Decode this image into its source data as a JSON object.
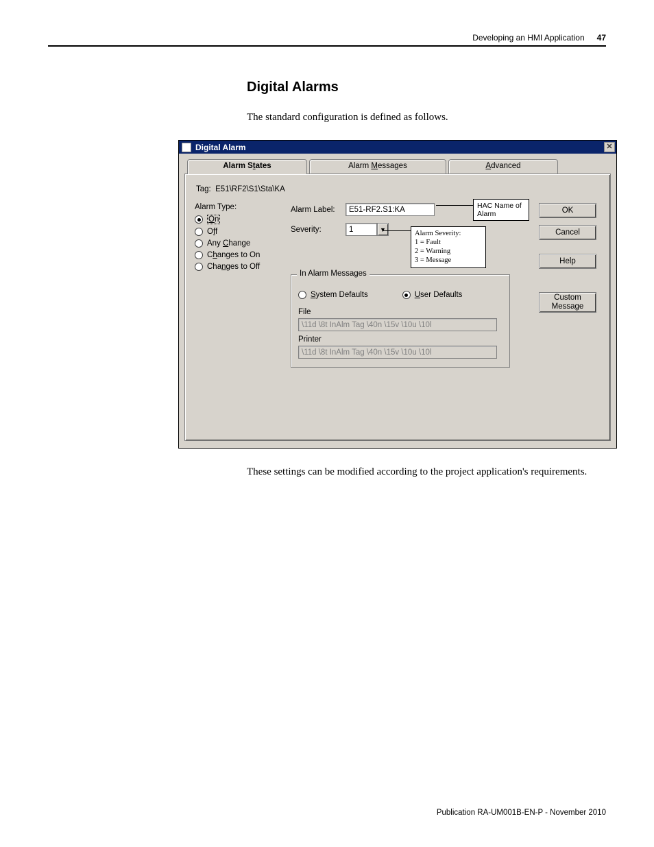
{
  "header": {
    "chapter": "Developing an HMI Application",
    "page_number": "47"
  },
  "section_title": "Digital Alarms",
  "intro_text": "The standard configuration is defined as follows.",
  "outro_text": "These settings can be modified according to the project application's requirements.",
  "footer": "Publication RA-UM001B-EN-P - November 2010",
  "dialog": {
    "title": "Digital Alarm",
    "tabs": {
      "states_pre": "Alarm S",
      "states_u": "t",
      "states_post": "ates",
      "messages_pre": "Alarm ",
      "messages_u": "M",
      "messages_post": "essages",
      "advanced_u": "A",
      "advanced_post": "dvanced"
    },
    "tag_label": "Tag:",
    "tag_value": "E51\\RF2\\S1\\Sta\\KA",
    "alarm_type_label": "Alarm Type:",
    "radios": {
      "on_u": "O",
      "on_post": "n",
      "off_pre": "O",
      "off_u": "f",
      "off_post": "f",
      "anychange_pre": "Any ",
      "anychange_u": "C",
      "anychange_post": "hange",
      "chg_on_pre": "C",
      "chg_on_u": "h",
      "chg_on_post": "anges to On",
      "chg_off_pre": "Cha",
      "chg_off_u": "n",
      "chg_off_post": "ges to Off"
    },
    "alarm_label_lbl_pre": "Alarm La",
    "alarm_label_lbl_u": "b",
    "alarm_label_lbl_post": "el:",
    "alarm_label_value": "E51-RF2.S1:KA",
    "severity_lbl_pre": "Se",
    "severity_lbl_u": "v",
    "severity_lbl_post": "erity:",
    "severity_value": "1",
    "callout_hac": "HAC Name of Alarm",
    "callout_sev_title": "Alarm Severity:",
    "callout_sev_1": "1 = Fault",
    "callout_sev_2": "2 = Warning",
    "callout_sev_3": "3 = Message",
    "group_legend": "In Alarm Messages",
    "sys_def_u": "S",
    "sys_def_post": "ystem Defaults",
    "usr_def_u": "U",
    "usr_def_post": "ser Defaults",
    "file_lbl_pre": "F",
    "file_lbl_u": "i",
    "file_lbl_post": "le",
    "file_value": "\\11d \\8t InAlm Tag \\40n \\15v \\10u \\10l",
    "printer_lbl_u": "P",
    "printer_lbl_post": "rinter",
    "printer_value": "\\11d \\8t InAlm Tag \\40n \\15v \\10u \\10l",
    "buttons": {
      "ok": "OK",
      "cancel": "Cancel",
      "help": "Help",
      "custom_u": "C",
      "custom_line1_post": "ustom",
      "custom_line2": "Message"
    }
  }
}
